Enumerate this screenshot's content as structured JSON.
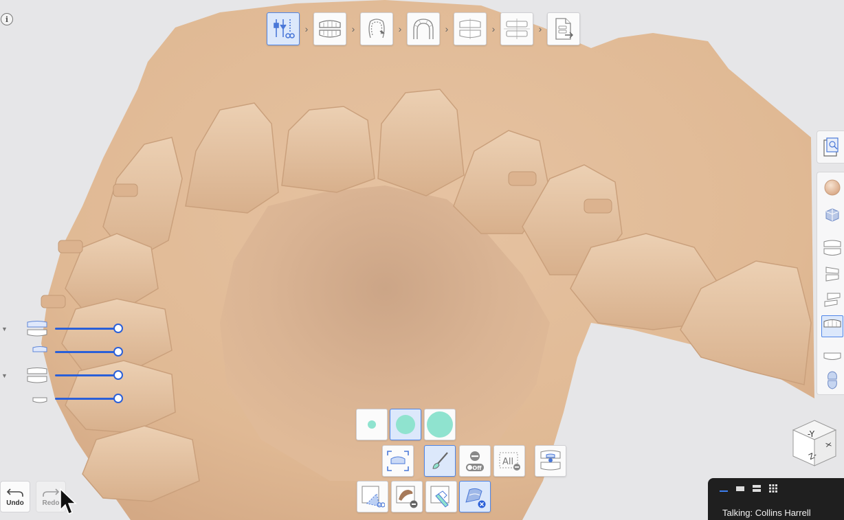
{
  "info": {
    "glyph": "i"
  },
  "workflow": {
    "steps": [
      {
        "id": "data-edit",
        "icon": "tools-scissors-icon",
        "active": true
      },
      {
        "id": "occlusion",
        "icon": "jaw-occlusion-icon",
        "active": false
      },
      {
        "id": "tooth-segmentation",
        "icon": "tooth-margin-icon",
        "active": false
      },
      {
        "id": "arch-line",
        "icon": "arch-curve-icon",
        "active": false
      },
      {
        "id": "alignment",
        "icon": "jaw-align-icon",
        "active": false
      },
      {
        "id": "base",
        "icon": "model-base-icon",
        "active": false
      },
      {
        "id": "export",
        "icon": "export-document-icon",
        "active": false
      }
    ],
    "separator": "›"
  },
  "right_panel": {
    "top_item": {
      "icon": "view-document-icon"
    },
    "items": [
      {
        "icon": "sphere-material-icon",
        "active": false
      },
      {
        "icon": "cube-texture-icon",
        "active": false
      },
      {
        "icon": "both-jaws-icon",
        "active": false
      },
      {
        "icon": "jaws-side-icon",
        "active": false
      },
      {
        "icon": "jaws-open-icon",
        "active": false
      },
      {
        "icon": "upper-jaw-icon",
        "active": true
      },
      {
        "icon": "lower-jaw-icon",
        "active": false
      },
      {
        "icon": "tooth-single-icon",
        "active": false
      }
    ]
  },
  "layers": [
    {
      "icon": "upper-jaw-layer-icon",
      "expandable": true,
      "opacity": 1.0
    },
    {
      "icon": "upper-jaw-thin-icon",
      "expandable": false,
      "opacity": 1.0
    },
    {
      "icon": "lower-jaw-layer-icon",
      "expandable": true,
      "opacity": 1.0
    },
    {
      "icon": "lower-jaw-thin-icon",
      "expandable": false,
      "opacity": 1.0
    }
  ],
  "brush_sizes": [
    {
      "size": "small",
      "active": false
    },
    {
      "size": "medium",
      "active": true
    },
    {
      "size": "large",
      "active": false
    }
  ],
  "tools_row1": [
    {
      "icon": "select-scan-icon",
      "active": false
    },
    {
      "icon": "brush-icon",
      "active": true
    },
    {
      "icon": "remove-off-icon",
      "label": "Off",
      "active": false
    },
    {
      "icon": "select-all-icon",
      "label": "All",
      "active": false
    },
    {
      "icon": "jaws-select-icon",
      "active": false
    }
  ],
  "tools_row2": [
    {
      "icon": "lasso-cut-icon",
      "active": false
    },
    {
      "icon": "smooth-remove-icon",
      "active": false
    },
    {
      "icon": "fill-brush-icon",
      "active": false
    },
    {
      "icon": "delete-selection-icon",
      "active": true
    }
  ],
  "undo": {
    "label": "Undo",
    "enabled": true
  },
  "redo": {
    "label": "Redo",
    "enabled": false
  },
  "orientation": {
    "top_label": "-Y",
    "side_label": "X",
    "front_label": "Z-"
  },
  "meeting": {
    "views": [
      "speaker-view-icon",
      "gallery-strip-icon",
      "stacked-view-icon",
      "grid-view-icon"
    ],
    "talking": "Talking: Collins Harrell"
  }
}
